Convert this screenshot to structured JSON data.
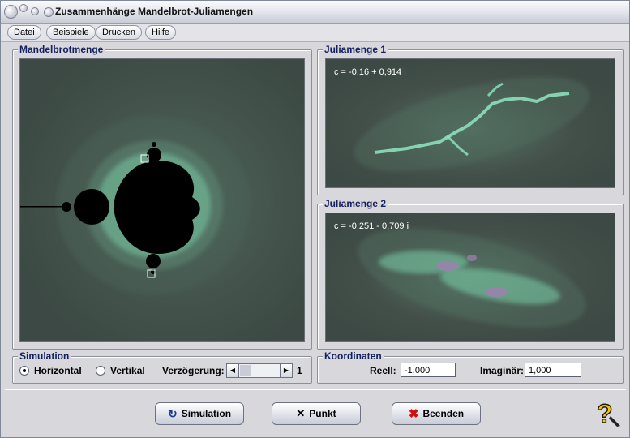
{
  "window": {
    "title": "Zusammenhänge Mandelbrot-Juliamengen"
  },
  "menu": [
    "Datei",
    "Beispiele",
    "Drucken",
    "Hilfe"
  ],
  "mandel": {
    "label": "Mandelbrotmenge"
  },
  "julia1": {
    "label": "Juliamenge 1",
    "param": "c = -0,16 + 0,914 i"
  },
  "julia2": {
    "label": "Juliamenge 2",
    "param": "c = -0,251 - 0,709 i"
  },
  "simulation": {
    "label": "Simulation",
    "horizontal": "Horizontal",
    "vertical": "Vertikal",
    "selected": "Horizontal",
    "delay_label": "Verzögerung:",
    "delay_value": "1"
  },
  "koordinaten": {
    "label": "Koordinaten",
    "reell_label": "Reell:",
    "reell_value": "-1,000",
    "imag_label": "Imaginär:",
    "imag_value": "1,000"
  },
  "buttons": {
    "simulation": "Simulation",
    "punkt": "Punkt",
    "beenden": "Beenden"
  },
  "colors": {
    "fractal_bg": "#3c4944",
    "glow": "#7fd9b0",
    "group_label": "#12205e",
    "beenden_x": "#d01010"
  }
}
